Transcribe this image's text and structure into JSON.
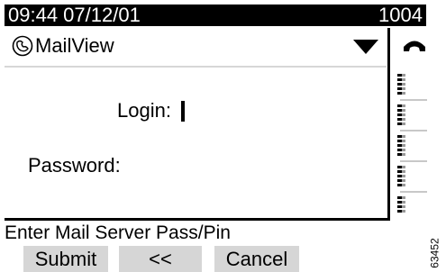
{
  "status": {
    "datetime": "09:44 07/12/01",
    "extension": "1004"
  },
  "app": {
    "icon": "voicemail-icon",
    "title": "MailView",
    "dropdown_icon": "dropdown-arrow-icon"
  },
  "phone_icon": "phone-handset-icon",
  "form": {
    "login_label": "Login:",
    "password_label": "Password:"
  },
  "line_buttons": [
    "line-button-icon",
    "line-button-icon",
    "line-button-icon",
    "line-button-icon",
    "line-button-icon"
  ],
  "prompt": "Enter Mail Server Pass/Pin",
  "softkeys": {
    "submit": "Submit",
    "back": "<<",
    "cancel": "Cancel"
  },
  "figure_id": "63452"
}
